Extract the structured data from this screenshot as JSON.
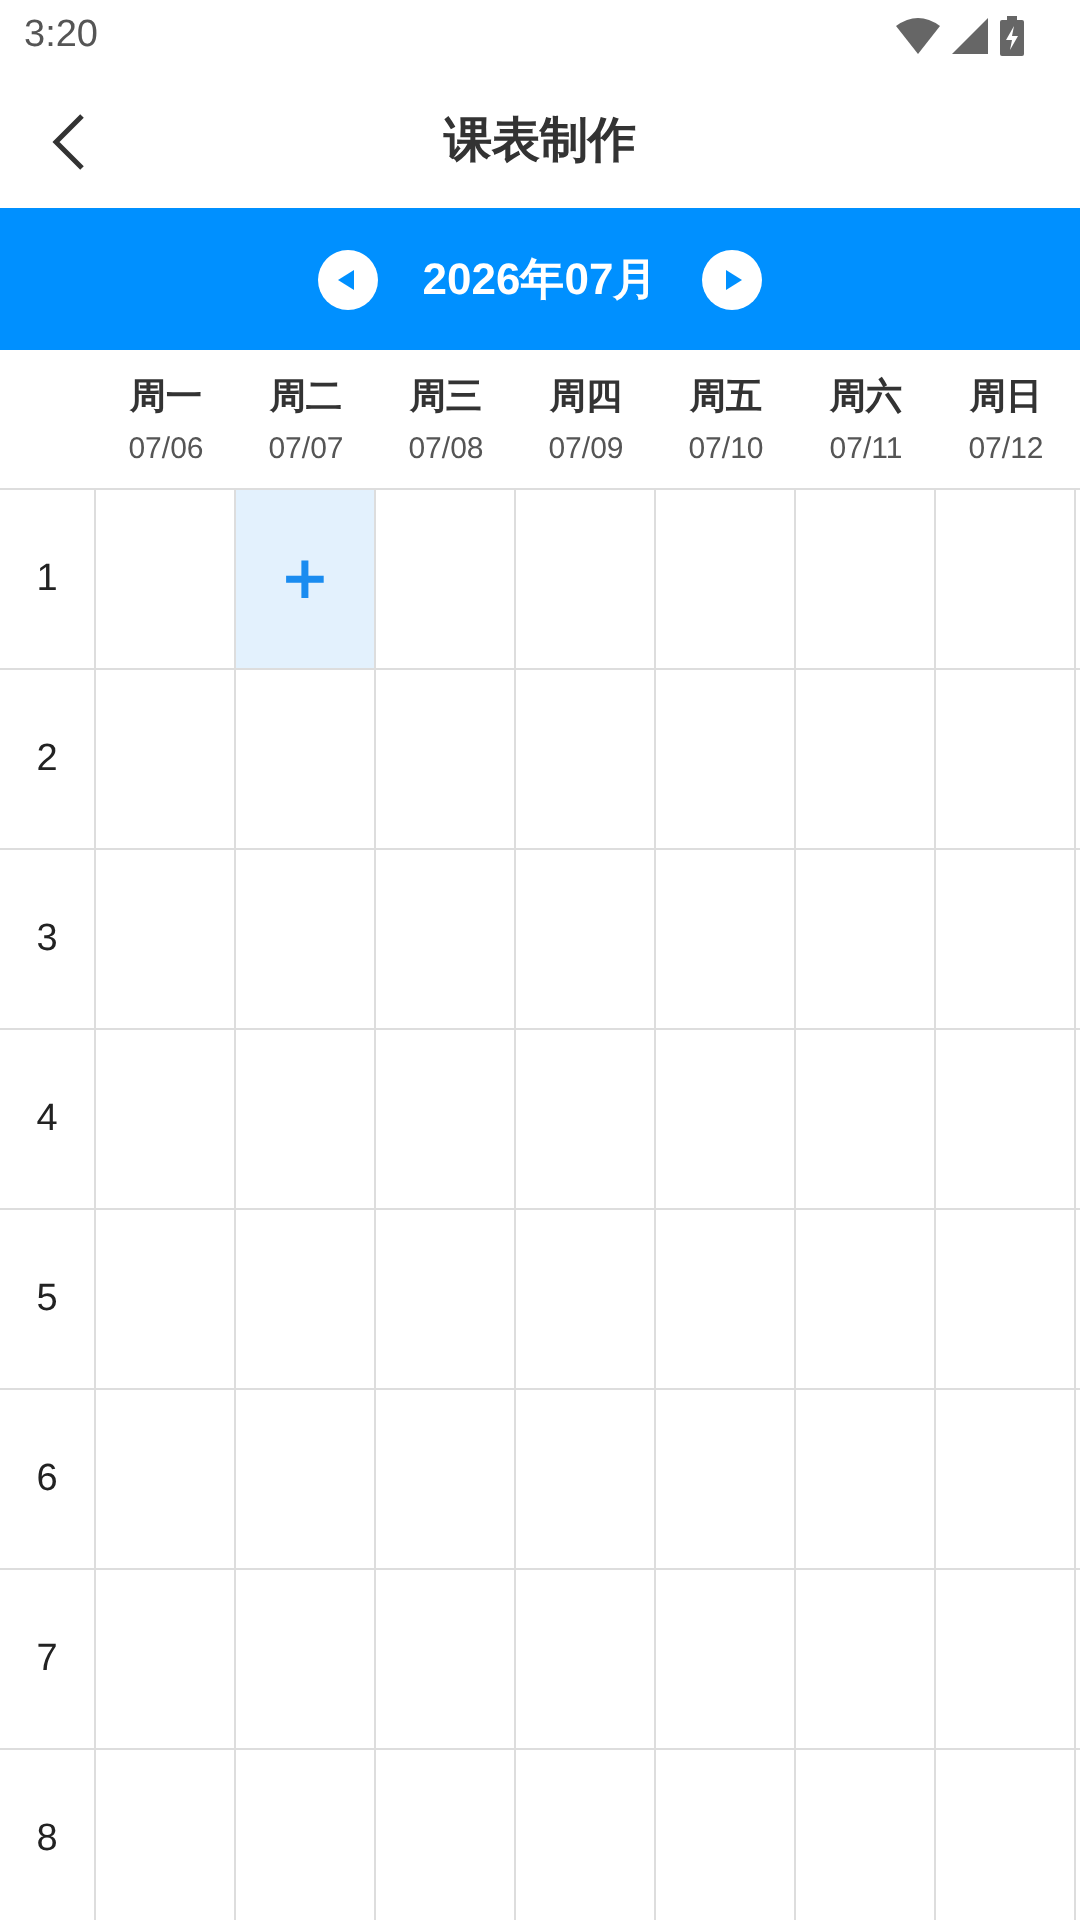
{
  "status_bar": {
    "time": "3:20"
  },
  "header": {
    "title": "课表制作"
  },
  "month_nav": {
    "label": "2026年07月"
  },
  "days": [
    {
      "name": "周一",
      "date": "07/06"
    },
    {
      "name": "周二",
      "date": "07/07"
    },
    {
      "name": "周三",
      "date": "07/08"
    },
    {
      "name": "周四",
      "date": "07/09"
    },
    {
      "name": "周五",
      "date": "07/10"
    },
    {
      "name": "周六",
      "date": "07/11"
    },
    {
      "name": "周日",
      "date": "07/12"
    }
  ],
  "rows": [
    {
      "period": "1",
      "cells": [
        {
          "selected": false
        },
        {
          "selected": true,
          "text": "+"
        },
        {
          "selected": false
        },
        {
          "selected": false
        },
        {
          "selected": false
        },
        {
          "selected": false
        },
        {
          "selected": false
        }
      ]
    },
    {
      "period": "2",
      "cells": [
        {
          "selected": false
        },
        {
          "selected": false
        },
        {
          "selected": false
        },
        {
          "selected": false
        },
        {
          "selected": false
        },
        {
          "selected": false
        },
        {
          "selected": false
        }
      ]
    },
    {
      "period": "3",
      "cells": [
        {
          "selected": false
        },
        {
          "selected": false
        },
        {
          "selected": false
        },
        {
          "selected": false
        },
        {
          "selected": false
        },
        {
          "selected": false
        },
        {
          "selected": false
        }
      ]
    },
    {
      "period": "4",
      "cells": [
        {
          "selected": false
        },
        {
          "selected": false
        },
        {
          "selected": false
        },
        {
          "selected": false
        },
        {
          "selected": false
        },
        {
          "selected": false
        },
        {
          "selected": false
        }
      ]
    },
    {
      "period": "5",
      "cells": [
        {
          "selected": false
        },
        {
          "selected": false
        },
        {
          "selected": false
        },
        {
          "selected": false
        },
        {
          "selected": false
        },
        {
          "selected": false
        },
        {
          "selected": false
        }
      ]
    },
    {
      "period": "6",
      "cells": [
        {
          "selected": false
        },
        {
          "selected": false
        },
        {
          "selected": false
        },
        {
          "selected": false
        },
        {
          "selected": false
        },
        {
          "selected": false
        },
        {
          "selected": false
        }
      ]
    },
    {
      "period": "7",
      "cells": [
        {
          "selected": false
        },
        {
          "selected": false
        },
        {
          "selected": false
        },
        {
          "selected": false
        },
        {
          "selected": false
        },
        {
          "selected": false
        },
        {
          "selected": false
        }
      ]
    },
    {
      "period": "8",
      "cells": [
        {
          "selected": false
        },
        {
          "selected": false
        },
        {
          "selected": false
        },
        {
          "selected": false
        },
        {
          "selected": false
        },
        {
          "selected": false
        },
        {
          "selected": false
        }
      ]
    }
  ]
}
